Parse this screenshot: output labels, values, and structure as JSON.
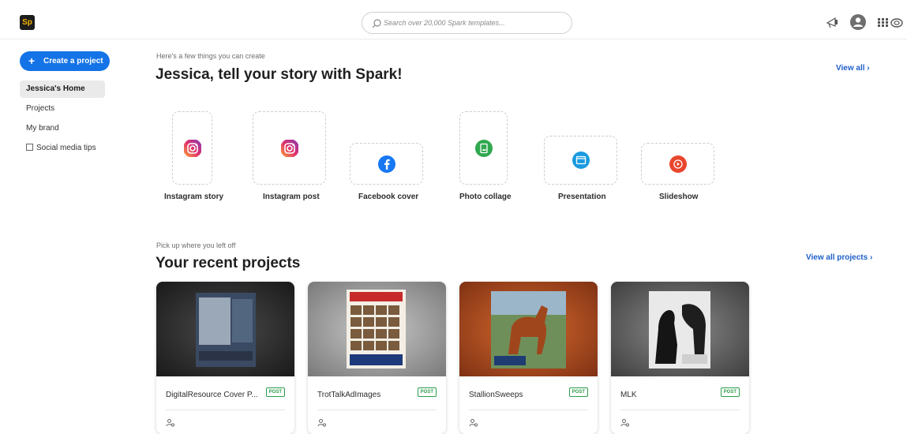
{
  "app": {
    "logo_text": "Sp",
    "brand_color": "#1d1d1d",
    "accent_color": "#1473e6"
  },
  "search": {
    "placeholder": "Search over 20,000 Spark templates..."
  },
  "header_icons": [
    "megaphone-icon",
    "avatar-icon",
    "apps-grid-icon",
    "creative-cloud-icon"
  ],
  "sidebar": {
    "create_label": "Create a project",
    "items": [
      {
        "label": "Jessica's Home",
        "active": true
      },
      {
        "label": "Projects"
      },
      {
        "label": "My brand"
      },
      {
        "label": "Social media tips",
        "external": true
      }
    ]
  },
  "create_section": {
    "eyebrow": "Here's a few things you can create",
    "heading": "Jessica, tell your story with Spark!",
    "view_all": "View all",
    "tiles": [
      {
        "label": "Instagram story",
        "icon": "instagram-icon"
      },
      {
        "label": "Instagram post",
        "icon": "instagram-icon"
      },
      {
        "label": "Facebook cover",
        "icon": "facebook-icon"
      },
      {
        "label": "Photo collage",
        "icon": "photo-collage-icon"
      },
      {
        "label": "Presentation",
        "icon": "presentation-icon"
      },
      {
        "label": "Slideshow",
        "icon": "slideshow-icon"
      }
    ]
  },
  "recent_section": {
    "eyebrow": "Pick up where you left off",
    "heading": "Your recent projects",
    "view_all": "View all projects",
    "projects": [
      {
        "title": "DigitalResource Cover P...",
        "badge": "POST"
      },
      {
        "title": "TrotTalkAdImages",
        "badge": "POST"
      },
      {
        "title": "StallionSweeps",
        "badge": "POST"
      },
      {
        "title": "MLK",
        "badge": "POST"
      }
    ]
  }
}
